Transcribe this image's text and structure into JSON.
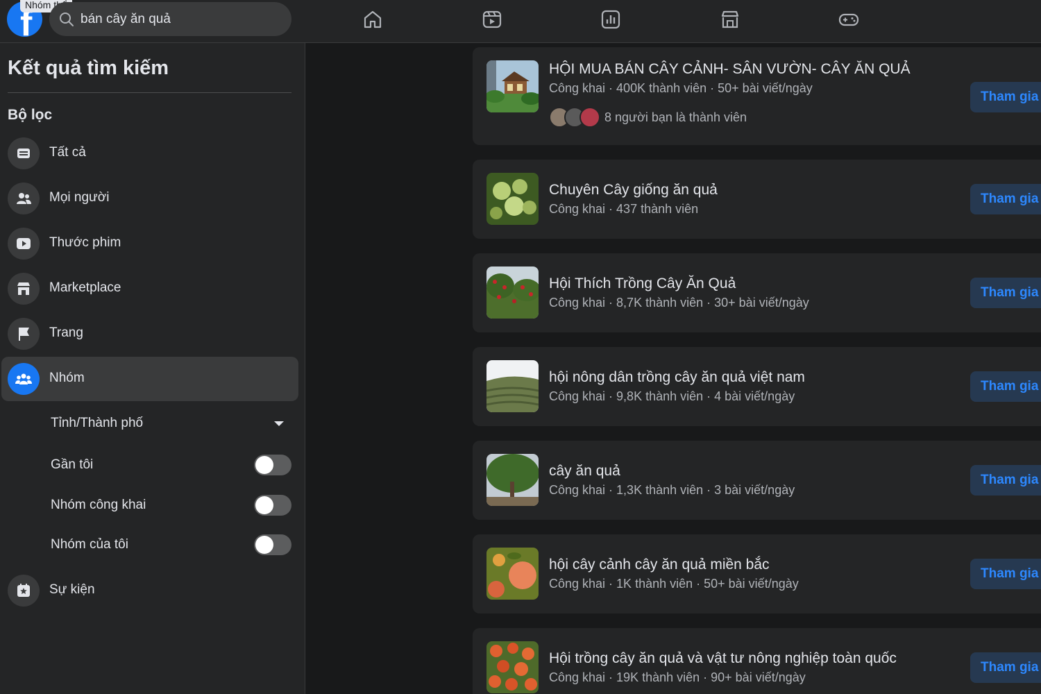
{
  "topbar": {
    "logo_letter": "f",
    "tooltip": "Nhóm thể",
    "search_value": "bán cây ăn quả",
    "nav_icons": [
      "home-icon",
      "watch-icon",
      "ads-chart-icon",
      "marketplace-icon",
      "gaming-icon"
    ]
  },
  "sidebar": {
    "title": "Kết quả tìm kiếm",
    "filters_heading": "Bộ lọc",
    "filters": [
      {
        "label": "Tất cả",
        "icon": "all-results-icon"
      },
      {
        "label": "Mọi người",
        "icon": "people-icon"
      },
      {
        "label": "Thước phim",
        "icon": "reels-icon"
      },
      {
        "label": "Marketplace",
        "icon": "marketplace-icon"
      },
      {
        "label": "Trang",
        "icon": "flag-icon"
      },
      {
        "label": "Nhóm",
        "icon": "groups-icon",
        "active": true
      },
      {
        "label": "Sự kiện",
        "icon": "event-star-icon"
      }
    ],
    "group_options": {
      "location": "Tỉnh/Thành phố",
      "near_me": "Gần tôi",
      "public_groups": "Nhóm công khai",
      "my_groups": "Nhóm của tôi"
    }
  },
  "results": [
    {
      "title": "HỘI MUA BÁN CÂY CẢNH- SÂN VƯỜN- CÂY ĂN QUẢ",
      "meta": "Công khai · 400K thành viên · 50+ bài viết/ngày",
      "friends": "8 người bạn là thành viên",
      "button": "Tham gia"
    },
    {
      "title": "Chuyên Cây giống ăn quả",
      "meta": "Công khai · 437 thành viên",
      "button": "Tham gia"
    },
    {
      "title": "Hội Thích Trồng Cây Ăn Quả",
      "meta": "Công khai · 8,7K thành viên · 30+ bài viết/ngày",
      "button": "Tham gia"
    },
    {
      "title": "hội nông dân trồng cây ăn quả việt nam",
      "meta": "Công khai · 9,8K thành viên · 4 bài viết/ngày",
      "button": "Tham gia"
    },
    {
      "title": "cây ăn quả",
      "meta": "Công khai · 1,3K thành viên · 3 bài viết/ngày",
      "button": "Tham gia"
    },
    {
      "title": "hội cây cảnh cây ăn quả miền bắc",
      "meta": "Công khai · 1K thành viên · 50+ bài viết/ngày",
      "button": "Tham gia"
    },
    {
      "title": "Hội trồng cây ăn quả và vật tư nông nghiệp toàn quốc",
      "meta": "Công khai · 19K thành viên · 90+ bài viết/ngày",
      "button": "Tham gia"
    }
  ],
  "colors": {
    "background": "#18191a",
    "surface": "#242526",
    "accent": "#1877f2",
    "join_button_bg": "#263951",
    "join_button_text": "#2d88ff"
  }
}
